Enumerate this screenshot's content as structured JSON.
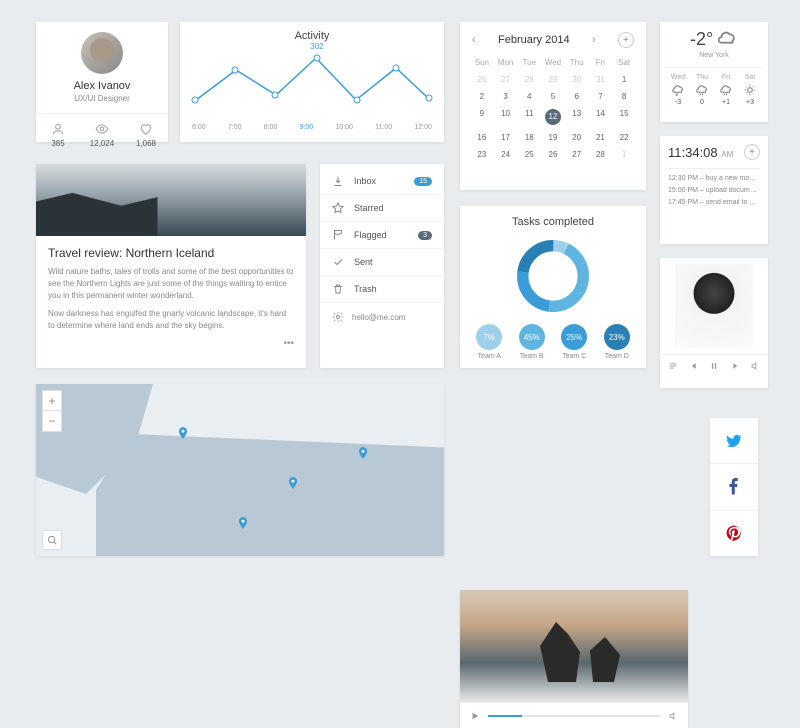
{
  "profile": {
    "name": "Alex Ivanov",
    "role": "UX/UI Designer",
    "followers": "385",
    "views": "12,024",
    "likes": "1,068"
  },
  "activity": {
    "title": "Activity",
    "peak_label": "302",
    "xaxis": [
      "6:00",
      "7:00",
      "8:00",
      "9:00",
      "10:00",
      "11:00",
      "12:00"
    ]
  },
  "chart_data": {
    "type": "line",
    "title": "Activity",
    "x": [
      "6:00",
      "7:00",
      "8:00",
      "9:00",
      "10:00",
      "11:00",
      "12:00"
    ],
    "values": [
      120,
      250,
      150,
      302,
      130,
      260,
      140
    ],
    "peak_index": 3,
    "peak_value": 302,
    "ylim": [
      0,
      320
    ]
  },
  "calendar": {
    "month": "February 2014",
    "dows": [
      "Sun",
      "Mon",
      "Tue",
      "Wed",
      "Thu",
      "Fri",
      "Sat"
    ],
    "leading_dim": [
      "26",
      "27",
      "28",
      "29",
      "30",
      "31"
    ],
    "days": [
      "1",
      "2",
      "3",
      "4",
      "5",
      "6",
      "7",
      "8",
      "9",
      "10",
      "11",
      "12",
      "13",
      "14",
      "15",
      "16",
      "17",
      "18",
      "19",
      "20",
      "21",
      "22",
      "23",
      "24",
      "25",
      "26",
      "27",
      "28"
    ],
    "trailing_dim": [
      "1"
    ],
    "today": "12"
  },
  "weather": {
    "temp": "-2°",
    "city": "New York",
    "days": [
      {
        "d": "Wed",
        "t": "-3"
      },
      {
        "d": "Thu",
        "t": "0"
      },
      {
        "d": "Fri",
        "t": "+1"
      },
      {
        "d": "Sat",
        "t": "+3"
      }
    ]
  },
  "clock": {
    "time": "11:34:08",
    "ampm": "AM",
    "events": [
      {
        "t": "12:30 PM",
        "txt": "buy a new mouse"
      },
      {
        "t": "15:00 PM",
        "txt": "upload documents for..."
      },
      {
        "t": "17:45 PM",
        "txt": "send email to Rachel"
      }
    ]
  },
  "article": {
    "title": "Travel review: Northern Iceland",
    "p1": "Wild nature baths, tales of trolls and some of the best opportunities to see the Northern Lights are just some of the things waiting to entice you in this permanent winter wonderland.",
    "p2": "Now darkness has engulfed the gnarly volcanic landscape, it's hard to determine where land ends and the sky begins."
  },
  "mail": {
    "items": [
      {
        "label": "Inbox",
        "badge": "15"
      },
      {
        "label": "Starred"
      },
      {
        "label": "Flagged",
        "badge": "3",
        "dark": true
      },
      {
        "label": "Sent"
      },
      {
        "label": "Trash"
      }
    ],
    "email": "hello@me.com"
  },
  "tasks": {
    "title": "Tasks completed",
    "teams": [
      {
        "label": "Team A",
        "pct": "7%",
        "color": "#9ed0eb"
      },
      {
        "label": "Team B",
        "pct": "45%",
        "color": "#5fb5e0"
      },
      {
        "label": "Team C",
        "pct": "25%",
        "color": "#3b9dd8"
      },
      {
        "label": "Team D",
        "pct": "23%",
        "color": "#2a7fb5"
      }
    ]
  },
  "social": {
    "twitter": "#1da1f2",
    "facebook": "#3b5998",
    "pinterest": "#bd081c"
  }
}
